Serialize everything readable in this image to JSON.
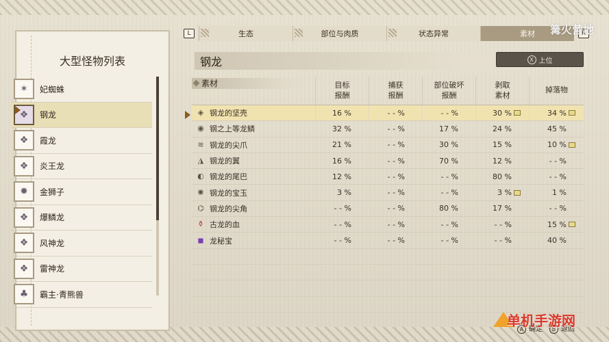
{
  "left_panel": {
    "title": "大型怪物列表",
    "monsters": [
      {
        "name": "妃蜘蛛",
        "icon": "spider-icon"
      },
      {
        "name": "钢龙",
        "icon": "dragon-icon",
        "selected": true
      },
      {
        "name": "霞龙",
        "icon": "dragon-icon"
      },
      {
        "name": "炎王龙",
        "icon": "dragon-icon"
      },
      {
        "name": "金狮子",
        "icon": "beast-icon"
      },
      {
        "name": "爆鳞龙",
        "icon": "dragon-icon"
      },
      {
        "name": "风神龙",
        "icon": "dragon-icon"
      },
      {
        "name": "雷神龙",
        "icon": "dragon-icon"
      },
      {
        "name": "霸主·青熊兽",
        "icon": "bear-icon"
      }
    ]
  },
  "tabs": {
    "left_key": "L",
    "right_key": "R",
    "items": [
      "生态",
      "部位与肉质",
      "状态异常",
      "素材"
    ],
    "active": 3
  },
  "header": {
    "monster_name": "钢龙",
    "up_button": "上位",
    "up_button_key": "X"
  },
  "table": {
    "columns": [
      "素材",
      "目标\n报酬",
      "捕获\n报酬",
      "部位破坏\n报酬",
      "剥取\n素材",
      "掉落物"
    ],
    "rows": [
      {
        "name": "钢龙的坚壳",
        "icon": "shell-icon",
        "values": [
          "16 %",
          "- - %",
          "- - %",
          "30 %",
          "34 %"
        ],
        "marks": [
          false,
          false,
          false,
          true,
          true
        ],
        "selected": true
      },
      {
        "name": "钢之上等龙鳞",
        "icon": "scale-icon",
        "values": [
          "32 %",
          "- - %",
          "17 %",
          "24 %",
          "45 %"
        ],
        "marks": [
          false,
          false,
          false,
          false,
          false
        ]
      },
      {
        "name": "钢龙的尖爪",
        "icon": "claw-icon",
        "values": [
          "21 %",
          "- - %",
          "30 %",
          "15 %",
          "10 %"
        ],
        "marks": [
          false,
          false,
          false,
          false,
          true
        ]
      },
      {
        "name": "钢龙的翼",
        "icon": "wing-icon",
        "values": [
          "16 %",
          "- - %",
          "70 %",
          "12 %",
          "- - %"
        ],
        "marks": [
          false,
          false,
          false,
          false,
          false
        ]
      },
      {
        "name": "钢龙的尾巴",
        "icon": "tail-icon",
        "values": [
          "12 %",
          "- - %",
          "- - %",
          "80 %",
          "- - %"
        ],
        "marks": [
          false,
          false,
          false,
          false,
          false
        ]
      },
      {
        "name": "钢龙的宝玉",
        "icon": "gem-icon",
        "values": [
          "3 %",
          "- - %",
          "- - %",
          "3 %",
          "1 %"
        ],
        "marks": [
          false,
          false,
          false,
          true,
          false
        ]
      },
      {
        "name": "钢龙的尖角",
        "icon": "horn-icon",
        "values": [
          "- - %",
          "- - %",
          "80 %",
          "17 %",
          "- - %"
        ],
        "marks": [
          false,
          false,
          false,
          false,
          false
        ]
      },
      {
        "name": "古龙的血",
        "icon": "blood-icon",
        "values": [
          "- - %",
          "- - %",
          "- - %",
          "- - %",
          "15 %"
        ],
        "marks": [
          false,
          false,
          false,
          false,
          true
        ]
      },
      {
        "name": "龙秘宝",
        "icon": "treasure-icon",
        "values": [
          "- - %",
          "- - %",
          "- - %",
          "- - %",
          "40 %"
        ],
        "marks": [
          false,
          false,
          false,
          false,
          false
        ]
      }
    ]
  },
  "footer": {
    "confirm_label": "确定",
    "back_label": "返回",
    "confirm_key": "A",
    "back_key": "B"
  },
  "watermarks": {
    "top": "篝火营地",
    "bottom": "单机手游网"
  }
}
